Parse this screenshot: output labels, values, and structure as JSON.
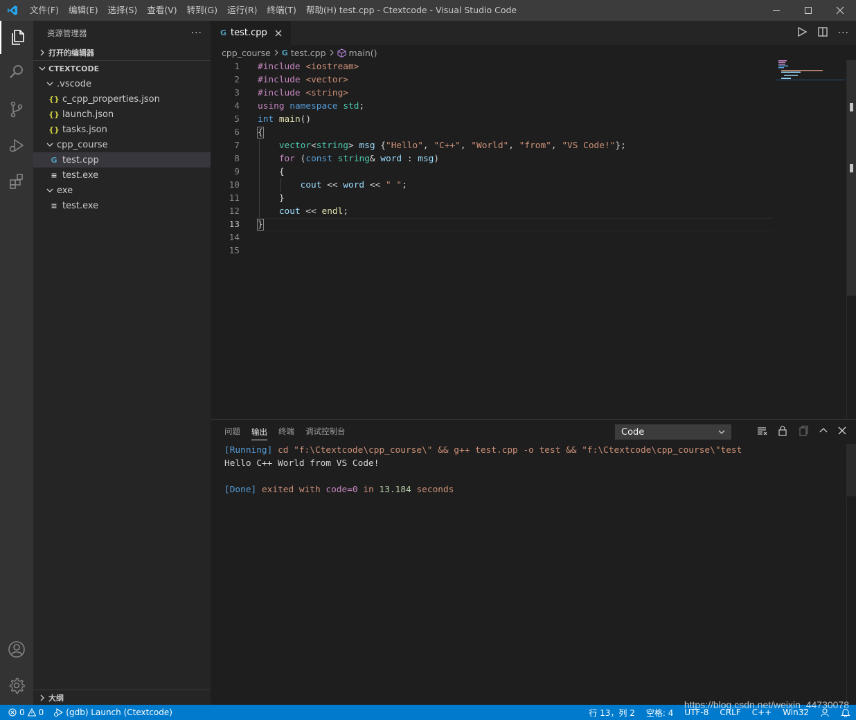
{
  "titlebar": {
    "menu": [
      "文件(F)",
      "编辑(E)",
      "选择(S)",
      "查看(V)",
      "转到(G)",
      "运行(R)",
      "终端(T)",
      "帮助(H)"
    ],
    "title": "test.cpp - Ctextcode - Visual Studio Code"
  },
  "sidebar": {
    "header": "资源管理器",
    "open_editors": "打开的编辑器",
    "workspace": "CTEXTCODE",
    "tree": [
      {
        "label": ".vscode",
        "type": "folder",
        "depth": 1
      },
      {
        "label": "c_cpp_properties.json",
        "type": "json",
        "depth": 2
      },
      {
        "label": "launch.json",
        "type": "json",
        "depth": 2
      },
      {
        "label": "tasks.json",
        "type": "json",
        "depth": 2
      },
      {
        "label": "cpp_course",
        "type": "folder",
        "depth": 1
      },
      {
        "label": "test.cpp",
        "type": "cpp",
        "depth": 2,
        "selected": true
      },
      {
        "label": "test.exe",
        "type": "exe",
        "depth": 2
      },
      {
        "label": "exe",
        "type": "folder",
        "depth": 1
      },
      {
        "label": "test.exe",
        "type": "exe",
        "depth": 2
      }
    ],
    "outline": "大纲"
  },
  "editor": {
    "tab_label": "test.cpp",
    "breadcrumb": [
      "cpp_course",
      "test.cpp",
      "main()"
    ],
    "line_numbers": [
      "1",
      "2",
      "3",
      "4",
      "5",
      "6",
      "7",
      "8",
      "9",
      "10",
      "11",
      "12",
      "13",
      "14",
      "15"
    ],
    "active_line": "13"
  },
  "panel": {
    "tabs": [
      "问题",
      "输出",
      "终端",
      "调试控制台"
    ],
    "active_tab": "输出",
    "output_channel": "Code",
    "output": {
      "running_tag": "[Running]",
      "command": "cd \"f:\\Ctextcode\\cpp_course\\\" && g++ test.cpp -o test && \"f:\\Ctextcode\\cpp_course\\\"test",
      "program_output": "Hello C++ World from VS Code!",
      "done_tag": "[Done]",
      "exited_with": "exited with",
      "code": "code=0",
      "in": "in",
      "seconds_value": "13.184",
      "seconds": "seconds"
    }
  },
  "statusbar": {
    "errors": "0",
    "warnings": "0",
    "launch": "(gdb) Launch (Ctextcode)",
    "position": "行 13，列 2",
    "spaces": "空格: 4",
    "encoding": "UTF-8",
    "eol": "CRLF",
    "language": "C++",
    "platform": "Win32"
  },
  "watermark": "https://blog.csdn.net/weixin_44730078",
  "colors": {
    "accent": "#007acc",
    "activity_bar": "#333333",
    "sidebar": "#252526",
    "editor_bg": "#1e1e1e"
  }
}
